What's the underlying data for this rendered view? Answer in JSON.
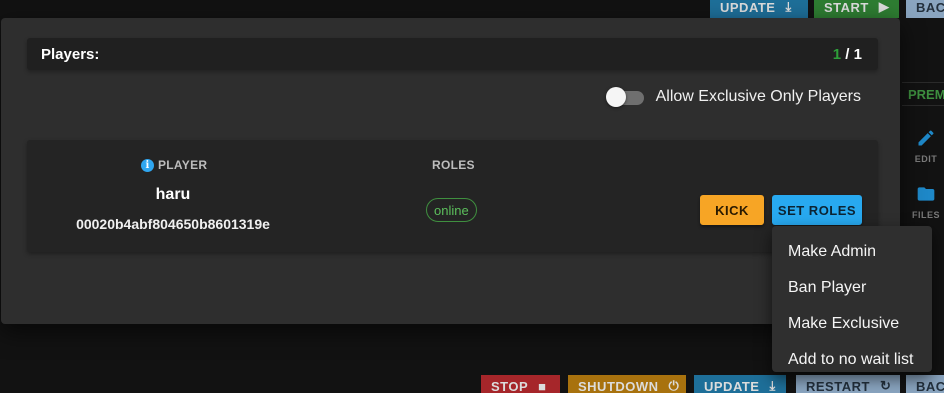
{
  "background": {
    "top_buttons": {
      "update": "UPDATE",
      "start": "START",
      "back": "BAC"
    },
    "bottom_buttons": {
      "stop": "STOP",
      "shutdown": "SHUTDOWN",
      "update": "UPDATE",
      "restart": "RESTART",
      "back": "BAC"
    },
    "side": {
      "prem": "PREM",
      "edit": "EDIT",
      "files": "FILES"
    }
  },
  "dialog": {
    "title": "Players:",
    "count_current": "1",
    "count_separator": " / ",
    "count_max": "1",
    "exclusive_toggle": {
      "label": "Allow Exclusive Only Players",
      "checked": false
    }
  },
  "table": {
    "columns": {
      "player": "PLAYER",
      "roles": "ROLES"
    },
    "row": {
      "name": "haru",
      "id": "00020b4abf804650b8601319e",
      "role": "online",
      "kick_label": "KICK",
      "set_roles_label": "SET ROLES"
    }
  },
  "menu": {
    "items": [
      "Make Admin",
      "Ban Player",
      "Make Exclusive",
      "Add to no wait list"
    ]
  },
  "colors": {
    "accent_blue": "#28a9f0",
    "kick_orange": "#f7a525",
    "online_green": "#5cbf5c"
  }
}
